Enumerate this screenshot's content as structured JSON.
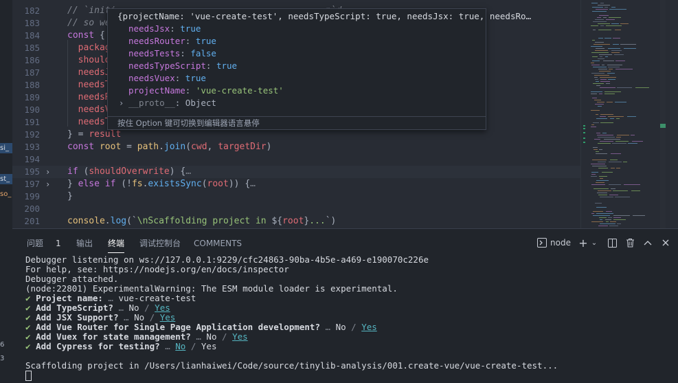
{
  "left_strip": {
    "items": [
      "si_",
      "st_",
      "so_",
      "6",
      "3"
    ]
  },
  "editor": {
    "lines": [
      {
        "n": "182",
        "code": [
          [
            "cm",
            "// `initi"
          ],
          [
            "cm",
            "                                    "
          ],
          [
            "cm",
            "...n`d"
          ]
        ]
      },
      {
        "n": "183",
        "code": [
          [
            "cm",
            "// so we"
          ]
        ]
      },
      {
        "n": "184",
        "code": [
          [
            "kw",
            "const"
          ],
          [
            "pl",
            " {"
          ]
        ]
      },
      {
        "n": "185",
        "code": [
          [
            "pl",
            "  "
          ],
          [
            "prop",
            "packag"
          ]
        ]
      },
      {
        "n": "186",
        "code": [
          [
            "pl",
            "  "
          ],
          [
            "prop",
            "should"
          ]
        ]
      },
      {
        "n": "187",
        "code": [
          [
            "pl",
            "  "
          ],
          [
            "prop",
            "needsJ"
          ]
        ]
      },
      {
        "n": "188",
        "code": [
          [
            "pl",
            "  "
          ],
          [
            "prop",
            "needsT"
          ]
        ]
      },
      {
        "n": "189",
        "code": [
          [
            "pl",
            "  "
          ],
          [
            "prop",
            "needsR"
          ]
        ]
      },
      {
        "n": "190",
        "code": [
          [
            "pl",
            "  "
          ],
          [
            "prop",
            "needsV"
          ]
        ]
      },
      {
        "n": "191",
        "code": [
          [
            "pl",
            "  "
          ],
          [
            "prop",
            "needsT"
          ]
        ]
      },
      {
        "n": "192",
        "code": [
          [
            "pl",
            "} = "
          ],
          [
            "prop",
            "result"
          ]
        ]
      },
      {
        "n": "193",
        "code": [
          [
            "kw",
            "const"
          ],
          [
            "pl",
            " "
          ],
          [
            "var",
            "root"
          ],
          [
            "pl",
            " = "
          ],
          [
            "var",
            "path"
          ],
          [
            "pl",
            "."
          ],
          [
            "fn",
            "join"
          ],
          [
            "pl",
            "("
          ],
          [
            "prop",
            "cwd"
          ],
          [
            "pl",
            ", "
          ],
          [
            "prop",
            "targetDir"
          ],
          [
            "pl",
            ")"
          ]
        ]
      },
      {
        "n": "194",
        "code": []
      },
      {
        "n": "195",
        "code": [
          [
            "kw",
            "if"
          ],
          [
            "pl",
            " ("
          ],
          [
            "prop",
            "shouldOverwrite"
          ],
          [
            "pl",
            ") {"
          ],
          [
            "dots",
            "…"
          ]
        ],
        "fold": true,
        "hl": true
      },
      {
        "n": "197",
        "code": [
          [
            "pl",
            "} "
          ],
          [
            "kw",
            "else if"
          ],
          [
            "pl",
            " (!"
          ],
          [
            "var",
            "fs"
          ],
          [
            "pl",
            "."
          ],
          [
            "fn",
            "existsSync"
          ],
          [
            "pl",
            "("
          ],
          [
            "prop",
            "root"
          ],
          [
            "pl",
            ")) {"
          ],
          [
            "dots",
            "…"
          ]
        ],
        "fold": true
      },
      {
        "n": "199",
        "code": [
          [
            "pl",
            "}"
          ]
        ]
      },
      {
        "n": "200",
        "code": []
      },
      {
        "n": "201",
        "code": [
          [
            "var",
            "console"
          ],
          [
            "pl",
            "."
          ],
          [
            "fn",
            "log"
          ],
          [
            "pl",
            "(`"
          ],
          [
            "str",
            "\\nScaffolding project in "
          ],
          [
            "pl",
            "${"
          ],
          [
            "prop",
            "root"
          ],
          [
            "pl",
            "}"
          ],
          [
            "str",
            "..."
          ],
          [
            "pl",
            "`)"
          ]
        ]
      }
    ]
  },
  "hover": {
    "summary": "{projectName: 'vue-create-test', needsTypeScript: true, needsJsx: true, needsRo…",
    "props": [
      {
        "key": "needsJsx",
        "value": "true",
        "kind": "bool"
      },
      {
        "key": "needsRouter",
        "value": "true",
        "kind": "bool"
      },
      {
        "key": "needsTests",
        "value": "false",
        "kind": "bool"
      },
      {
        "key": "needsTypeScript",
        "value": "true",
        "kind": "bool"
      },
      {
        "key": "needsVuex",
        "value": "true",
        "kind": "bool"
      },
      {
        "key": "projectName",
        "value": "'vue-create-test'",
        "kind": "str"
      }
    ],
    "proto_key": "__proto__",
    "proto_value": "Object",
    "footer": "按住 Option 键可切换到编辑器语言悬停"
  },
  "panel": {
    "tabs": [
      {
        "label": "问题",
        "badge": "1"
      },
      {
        "label": "输出"
      },
      {
        "label": "终端",
        "active": true
      },
      {
        "label": "调试控制台"
      },
      {
        "label": "COMMENTS"
      }
    ],
    "terminal_name": "node"
  },
  "terminal": {
    "lines": [
      [
        [
          "p",
          "Debugger listening on ws://127.0.0.1:9229/cfc24863-90ba-4b5e-a469-e190070c226e"
        ]
      ],
      [
        [
          "p",
          "For help, see: https://nodejs.org/en/docs/inspector"
        ]
      ],
      [
        [
          "p",
          "Debugger attached."
        ]
      ],
      [
        [
          "p",
          "(node:22801) ExperimentalWarning: The ESM module loader is experimental."
        ]
      ],
      [
        [
          "ok",
          "✔ "
        ],
        [
          "b",
          "Project name:"
        ],
        [
          "d",
          " … "
        ],
        [
          "p",
          "vue-create-test"
        ]
      ],
      [
        [
          "ok",
          "✔ "
        ],
        [
          "b",
          "Add TypeScript?"
        ],
        [
          "d",
          " … "
        ],
        [
          "p",
          "No"
        ],
        [
          "d",
          " / "
        ],
        [
          "y",
          "Yes"
        ]
      ],
      [
        [
          "ok",
          "✔ "
        ],
        [
          "b",
          "Add JSX Support?"
        ],
        [
          "d",
          " … "
        ],
        [
          "p",
          "No"
        ],
        [
          "d",
          " / "
        ],
        [
          "y",
          "Yes"
        ]
      ],
      [
        [
          "ok",
          "✔ "
        ],
        [
          "b",
          "Add Vue Router for Single Page Application development?"
        ],
        [
          "d",
          " … "
        ],
        [
          "p",
          "No"
        ],
        [
          "d",
          " / "
        ],
        [
          "y",
          "Yes"
        ]
      ],
      [
        [
          "ok",
          "✔ "
        ],
        [
          "b",
          "Add Vuex for state management?"
        ],
        [
          "d",
          " … "
        ],
        [
          "p",
          "No"
        ],
        [
          "d",
          " / "
        ],
        [
          "y",
          "Yes"
        ]
      ],
      [
        [
          "ok",
          "✔ "
        ],
        [
          "b",
          "Add Cypress for testing?"
        ],
        [
          "d",
          " … "
        ],
        [
          "y",
          "No"
        ],
        [
          "d",
          " / "
        ],
        [
          "p",
          "Yes"
        ]
      ],
      [],
      [
        [
          "p",
          "Scaffolding project in /Users/lianhaiwei/Code/source/tinylib-analysis/001.create-vue/vue-create-test..."
        ]
      ]
    ]
  }
}
